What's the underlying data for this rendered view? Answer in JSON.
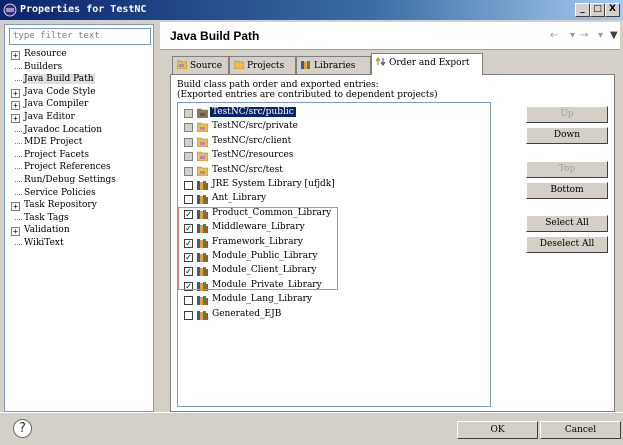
{
  "window": {
    "title": "Properties for TestNC",
    "min": "_",
    "max": "□",
    "close": "X"
  },
  "filter": {
    "placeholder": "type filter text"
  },
  "tree": [
    {
      "label": "Resource",
      "expandable": true
    },
    {
      "label": "Builders",
      "expandable": false
    },
    {
      "label": "Java Build Path",
      "expandable": false,
      "selected": true
    },
    {
      "label": "Java Code Style",
      "expandable": true
    },
    {
      "label": "Java Compiler",
      "expandable": true
    },
    {
      "label": "Java Editor",
      "expandable": true
    },
    {
      "label": "Javadoc Location",
      "expandable": false
    },
    {
      "label": "MDE Project",
      "expandable": false
    },
    {
      "label": "Project Facets",
      "expandable": false
    },
    {
      "label": "Project References",
      "expandable": false
    },
    {
      "label": "Run/Debug Settings",
      "expandable": false
    },
    {
      "label": "Service Policies",
      "expandable": false
    },
    {
      "label": "Task Repository",
      "expandable": true
    },
    {
      "label": "Task Tags",
      "expandable": false
    },
    {
      "label": "Validation",
      "expandable": true
    },
    {
      "label": "WikiText",
      "expandable": false
    }
  ],
  "page": {
    "title": "Java Build Path",
    "back_icon": "←",
    "forward_icon": "→",
    "menu_icon": "▼"
  },
  "tabs": [
    {
      "label": "Source",
      "icon": "source-folder-icon"
    },
    {
      "label": "Projects",
      "icon": "projects-folder-icon"
    },
    {
      "label": "Libraries",
      "icon": "libraries-icon"
    },
    {
      "label": "Order and Export",
      "icon": "order-export-icon",
      "active": true
    }
  ],
  "description": {
    "line1": "Build class path order and exported entries:",
    "line2": "(Exported entries are contributed to dependent projects)"
  },
  "entries": [
    {
      "label": "TestNC/src/public",
      "type": "folder-dark",
      "checked": false,
      "grey": true,
      "selected": true
    },
    {
      "label": "TestNC/src/private",
      "type": "folder",
      "checked": false,
      "grey": true
    },
    {
      "label": "TestNC/src/client",
      "type": "folder",
      "checked": false,
      "grey": true
    },
    {
      "label": "TestNC/resources",
      "type": "folder",
      "checked": false,
      "grey": true
    },
    {
      "label": "TestNC/src/test",
      "type": "folder",
      "checked": false,
      "grey": true
    },
    {
      "label": "JRE System Library [ufjdk]",
      "type": "library",
      "checked": false
    },
    {
      "label": "Ant_Library",
      "type": "library",
      "checked": false
    },
    {
      "label": "Product_Common_Library",
      "type": "library",
      "checked": true
    },
    {
      "label": "Middleware_Library",
      "type": "library",
      "checked": true
    },
    {
      "label": "Framework_Library",
      "type": "library",
      "checked": true
    },
    {
      "label": "Module_Public_Library",
      "type": "library",
      "checked": true
    },
    {
      "label": "Module_Client_Library",
      "type": "library",
      "checked": true
    },
    {
      "label": "Module_Private_Library",
      "type": "library",
      "checked": true
    },
    {
      "label": "Module_Lang_Library",
      "type": "library",
      "checked": false
    },
    {
      "label": "Generated_EJB",
      "type": "library",
      "checked": false
    }
  ],
  "buttons": {
    "up": "Up",
    "down": "Down",
    "top": "Top",
    "bottom": "Bottom",
    "select_all": "Select All",
    "deselect_all": "Deselect All"
  },
  "footer": {
    "help": "?",
    "ok": "OK",
    "cancel": "Cancel"
  },
  "colors": {
    "selection": "#0a246a",
    "title_bar": "#0a246a",
    "highlight_box": "#e08080"
  }
}
